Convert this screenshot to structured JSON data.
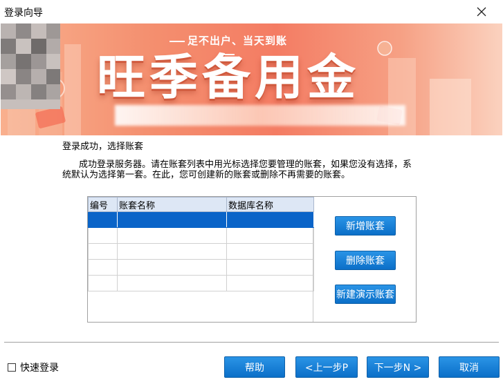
{
  "window": {
    "title": "登录向导"
  },
  "banner": {
    "slogan": "足不出户、当天到账",
    "brand": "旺季备用金"
  },
  "main": {
    "heading": "登录成功，选择账套",
    "description": "成功登录服务器。请在账套列表中用光标选择您要管理的账套，如果您没有选择，系统默认为选择第一套。在此，您可创建新的账套或删除不再需要的账套。"
  },
  "table": {
    "columns": [
      "编号",
      "账套名称",
      "数据库名称"
    ],
    "rows": [
      [
        "",
        "",
        ""
      ],
      [
        "",
        "",
        ""
      ],
      [
        "",
        "",
        ""
      ],
      [
        "",
        "",
        ""
      ],
      [
        "",
        "",
        ""
      ]
    ],
    "selected_row": 0
  },
  "side_buttons": {
    "add": "新增账套",
    "delete": "删除账套",
    "demo": "新建演示账套"
  },
  "footer": {
    "quick_login": "快速登录",
    "quick_login_checked": false,
    "help": "帮助",
    "prev": "<上一步P",
    "next": "下一步N >",
    "cancel": "取消"
  },
  "colors": {
    "accent_blue": "#0b6fc8",
    "banner_orange": "#f47c63",
    "selection": "#0a64c8"
  },
  "icons": {
    "close": "close-icon"
  }
}
